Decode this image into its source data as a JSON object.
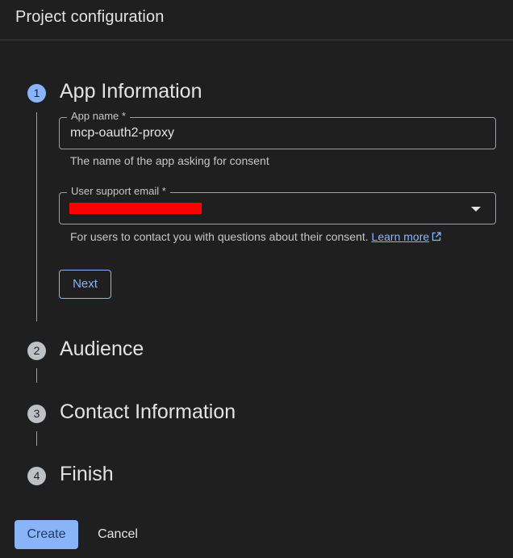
{
  "header": {
    "title": "Project configuration"
  },
  "steps": [
    {
      "number": "1",
      "title": "App Information",
      "state": "active"
    },
    {
      "number": "2",
      "title": "Audience",
      "state": "pending"
    },
    {
      "number": "3",
      "title": "Contact Information",
      "state": "pending"
    },
    {
      "number": "4",
      "title": "Finish",
      "state": "pending"
    }
  ],
  "app_info": {
    "app_name": {
      "label": "App name *",
      "value": "mcp-oauth2-proxy",
      "hint": "The name of the app asking for consent"
    },
    "support_email": {
      "label": "User support email *",
      "value_redacted": true,
      "hint": "For users to contact you with questions about their consent.",
      "learn_more": "Learn more"
    },
    "next_label": "Next"
  },
  "footer": {
    "create_label": "Create",
    "cancel_label": "Cancel"
  },
  "colors": {
    "background": "#1f1f1f",
    "accent": "#8ab4f8",
    "redaction": "#ff0000"
  },
  "icons": [
    "dropdown-arrow-icon",
    "external-link-icon"
  ]
}
